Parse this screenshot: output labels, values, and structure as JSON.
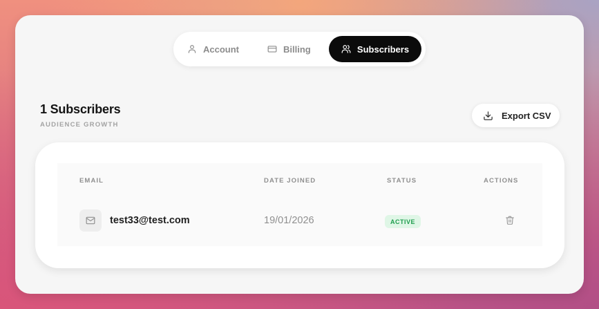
{
  "tabs": [
    {
      "label": "Account",
      "icon": "user-icon",
      "active": false
    },
    {
      "label": "Billing",
      "icon": "credit-card-icon",
      "active": false
    },
    {
      "label": "Subscribers",
      "icon": "users-icon",
      "active": true
    }
  ],
  "header": {
    "title": "1 Subscribers",
    "subtitle": "AUDIENCE GROWTH",
    "export_label": "Export CSV",
    "export_icon": "download-icon"
  },
  "table": {
    "columns": [
      "EMAIL",
      "DATE JOINED",
      "STATUS",
      "ACTIONS"
    ],
    "rows": [
      {
        "email": "test33@test.com",
        "date_joined": "19/01/2026",
        "status": "ACTIVE",
        "email_icon": "mail-icon",
        "action_icon": "trash-icon"
      }
    ]
  },
  "colors": {
    "active_tab_bg": "#0b0b0b",
    "status_active_bg": "#dff6e6",
    "status_active_text": "#1f9e4e"
  }
}
